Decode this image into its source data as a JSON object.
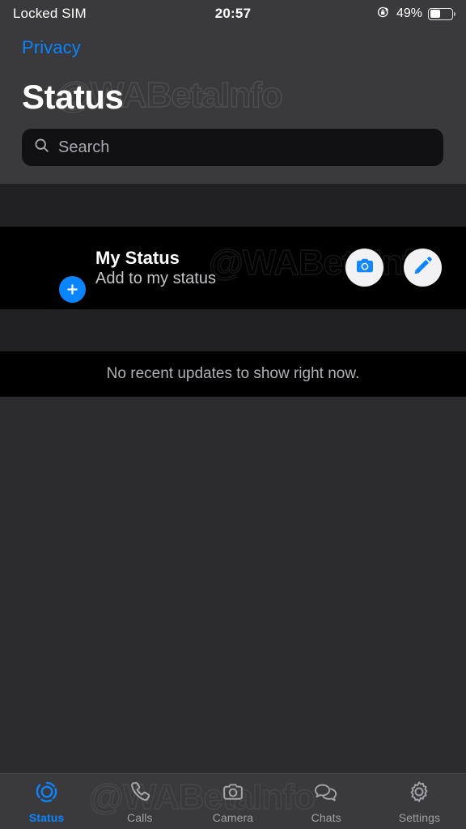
{
  "status_bar": {
    "carrier": "Locked SIM",
    "time": "20:57",
    "battery_percent": "49%",
    "battery_level": 49,
    "rotation_lock_icon": "rotation-lock-icon",
    "battery_icon": "battery-icon"
  },
  "header": {
    "back_label": "Privacy",
    "title": "Status",
    "search": {
      "placeholder": "Search",
      "value": "",
      "icon": "search-icon"
    }
  },
  "my_status": {
    "title": "My Status",
    "subtitle": "Add to my status",
    "add_badge_icon": "plus-icon",
    "camera_button_icon": "camera-icon",
    "edit_button_icon": "pencil-icon"
  },
  "recent_updates": {
    "empty_message": "No recent updates to show right now."
  },
  "tabs": [
    {
      "label": "Status",
      "icon": "status-ring-icon",
      "active": true
    },
    {
      "label": "Calls",
      "icon": "phone-icon",
      "active": false
    },
    {
      "label": "Camera",
      "icon": "camera-outline-icon",
      "active": false
    },
    {
      "label": "Chats",
      "icon": "chats-bubbles-icon",
      "active": false
    },
    {
      "label": "Settings",
      "icon": "gear-icon",
      "active": false
    }
  ],
  "watermark": {
    "text": "@WABetaInfo"
  },
  "colors": {
    "accent": "#0a84ff",
    "header_bg": "#3a3a3c",
    "section_gap_bg": "#212123",
    "row_bg": "#000000",
    "body_bg": "#2c2c2e",
    "primary_text": "#ffffff",
    "secondary_text": "#b0b0b5"
  }
}
